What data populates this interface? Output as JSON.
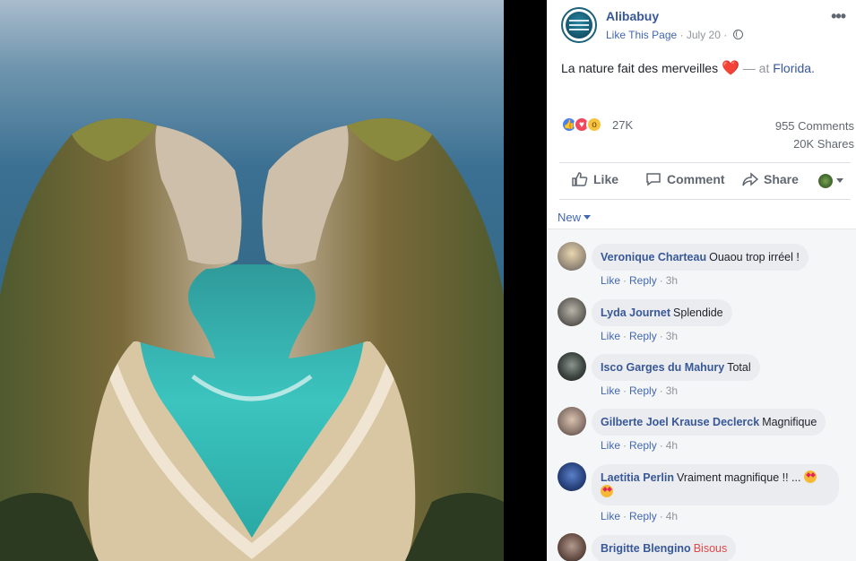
{
  "post": {
    "page_name": "Alibabuy",
    "like_page": "Like This Page",
    "date": "July 20",
    "text": "La nature fait des merveilles",
    "heart": "❤️",
    "at": "— at",
    "location": "Florida.",
    "reactions_count": "27K",
    "comments_count": "955 Comments",
    "shares_count": "20K Shares",
    "actions": {
      "like": "Like",
      "comment": "Comment",
      "share": "Share"
    },
    "sort_label": "New"
  },
  "comments": [
    {
      "name": "Veronique Charteau",
      "text": "Ouaou trop irréel !",
      "like": "Like",
      "reply": "Reply",
      "time": "3h"
    },
    {
      "name": "Lyda Journet",
      "text": "Splendide",
      "like": "Like",
      "reply": "Reply",
      "time": "3h"
    },
    {
      "name": "Isco Garges du Mahury",
      "text": "Total",
      "like": "Like",
      "reply": "Reply",
      "time": "3h"
    },
    {
      "name": "Gilberte Joel Krause Declerck",
      "text": "Magnifique",
      "like": "Like",
      "reply": "Reply",
      "time": "4h"
    },
    {
      "name": "Laetitia Perlin",
      "text": "Vraiment magnifique !! ...",
      "like": "Like",
      "reply": "Reply",
      "time": "4h"
    },
    {
      "name": "Brigitte Blengino",
      "text": "Bisous",
      "like": "",
      "reply": "",
      "time": ""
    }
  ],
  "colors": {
    "link": "#365899",
    "accent": "#4267b2",
    "muted": "#90949c",
    "bubble": "#eaecf0"
  }
}
